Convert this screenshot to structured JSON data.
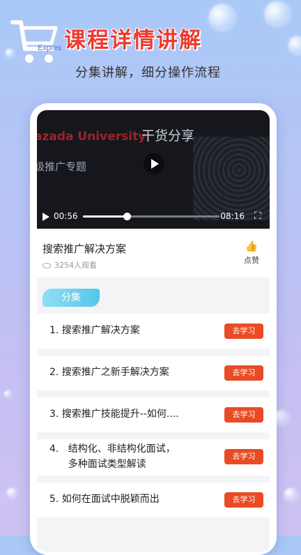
{
  "header": {
    "logo_text": "Expres",
    "headline": "课程详情讲解",
    "subline": "分集讲解，细分操作流程"
  },
  "video": {
    "overlay_title": "干货分享",
    "overlay_university": "azada University",
    "overlay_topic": "级推广专题",
    "current_time": "00:56",
    "duration": "08:16",
    "progress": 0.32
  },
  "course": {
    "title": "搜索推广解决方案",
    "views": "3254人观看",
    "like_label": "点赞"
  },
  "episodes": {
    "tab_label": "分集",
    "items": [
      {
        "title": "1.  搜索推广解决方案",
        "button": "去学习"
      },
      {
        "title": "2. 搜索推广之新手解决方案",
        "button": "去学习"
      },
      {
        "title": "3.  搜索推广技能提升--如何....",
        "button": "去学习"
      },
      {
        "line1": "4.   结构化、非结构化面试，",
        "line2": "      多种面试类型解读",
        "button": "去学习"
      },
      {
        "title": "5.  如何在面试中脱颖而出",
        "button": "去学习"
      }
    ]
  }
}
